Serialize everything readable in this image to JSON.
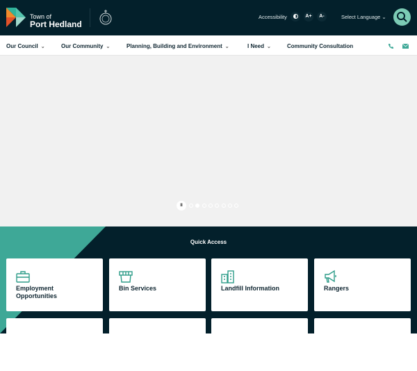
{
  "header": {
    "brand_line1": "Town of",
    "brand_line2": "Port Hedland",
    "accessibility_label": "Accessibility",
    "contrast_icon": "contrast-icon",
    "font_increase": "A+",
    "font_decrease": "A-",
    "language_label": "Select Language ⌄"
  },
  "nav": {
    "items": [
      {
        "label": "Our Council"
      },
      {
        "label": "Our Community"
      },
      {
        "label": "Planning, Building and Environment"
      },
      {
        "label": "I Need"
      },
      {
        "label": "Community Consultation"
      }
    ],
    "chevron": "⌄"
  },
  "slider": {
    "slide_count": 8,
    "active_index": 1,
    "pause_label": "II"
  },
  "quick_access": {
    "title": "Quick Access",
    "cards": [
      {
        "label": "Employment Opportunities",
        "icon": "briefcase-icon"
      },
      {
        "label": "Bin Services",
        "icon": "bin-icon"
      },
      {
        "label": "Landfill Information",
        "icon": "building-icon"
      },
      {
        "label": "Rangers",
        "icon": "megaphone-icon"
      }
    ]
  },
  "colors": {
    "dark": "#03202b",
    "teal": "#3ea897",
    "mint": "#7ccbb5"
  }
}
